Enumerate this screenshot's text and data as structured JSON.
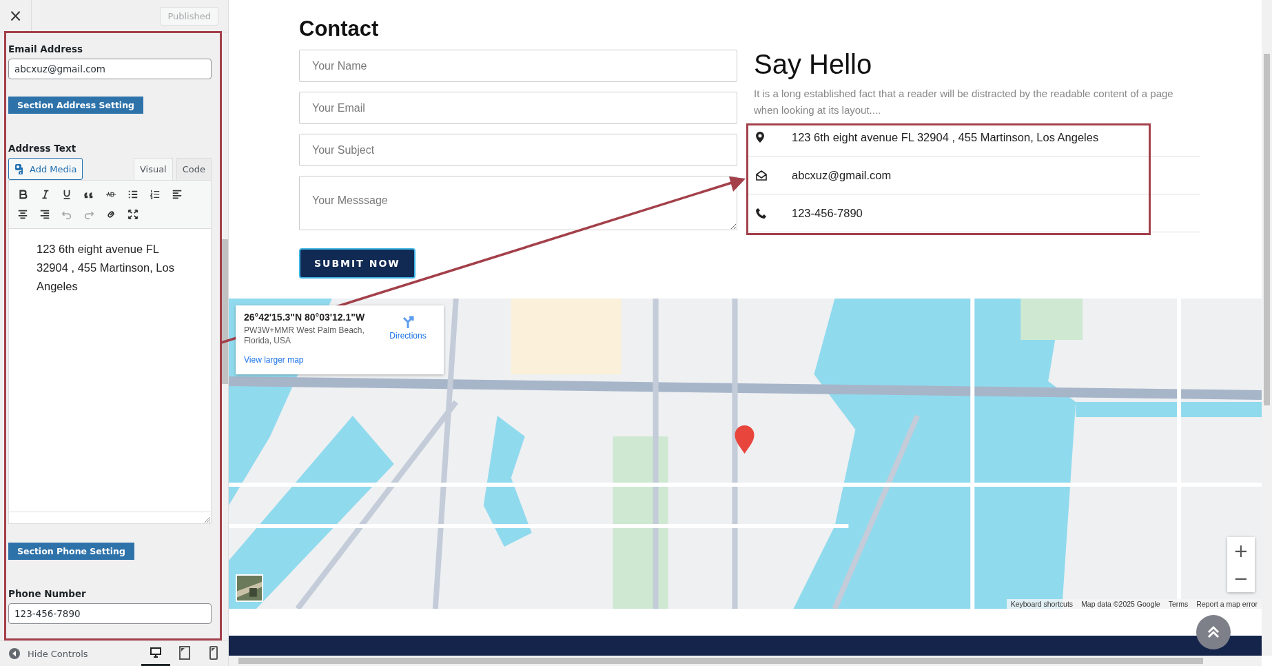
{
  "sidebar": {
    "close_label": "×",
    "publish_button": "Published",
    "email_label": "Email Address",
    "email_value": "abcxuz@gmail.com",
    "address_section_button": "Section Address Setting",
    "address_label": "Address Text",
    "add_media_button": "Add Media",
    "editor_tabs": [
      {
        "label": "Visual",
        "selected": true
      },
      {
        "label": "Code",
        "selected": false
      }
    ],
    "editor_text": "123 6th eight avenue FL 32904 , 455 Martinson, Los Angeles",
    "phone_section_button": "Section Phone Setting",
    "phone_label": "Phone Number",
    "phone_value": "123-456-7890"
  },
  "footer": {
    "hide_controls": "Hide Controls",
    "devices": [
      {
        "kind": "desktop",
        "selected": true
      },
      {
        "kind": "tablet",
        "selected": false
      },
      {
        "kind": "mobile",
        "selected": false
      }
    ]
  },
  "preview": {
    "contact_title": "Contact",
    "form_fields": [
      {
        "kind": "input",
        "placeholder": "Your Name"
      },
      {
        "kind": "input",
        "placeholder": "Your Email"
      },
      {
        "kind": "input",
        "placeholder": "Your Subject"
      },
      {
        "kind": "textarea",
        "placeholder": "Your Messsage"
      }
    ],
    "submit_button": "SUBMIT NOW",
    "say_hello_title": "Say Hello",
    "intro": "It is a long established fact that a reader will be distracted by the readable content of a page when looking at its layout....",
    "info_items": [
      {
        "kind": "location",
        "text": "123 6th eight avenue FL 32904 , 455 Martinson, Los Angeles"
      },
      {
        "kind": "email",
        "text": "abcxuz@gmail.com"
      },
      {
        "kind": "phone",
        "text": "123-456-7890"
      }
    ],
    "map": {
      "kind": "picture",
      "place_card": {
        "coordinates": "26°42'15.3\"N 80°03'12.1\"W",
        "address": "PW3W+MMR West Palm Beach, Florida, USA",
        "directions": "Directions",
        "larger_map_link": "View larger map"
      },
      "zoom_in": "+",
      "zoom_out": "−",
      "attribution": [
        "Keyboard shortcuts",
        "Map data ©2025 Google",
        "Terms",
        "Report a map error"
      ]
    }
  }
}
